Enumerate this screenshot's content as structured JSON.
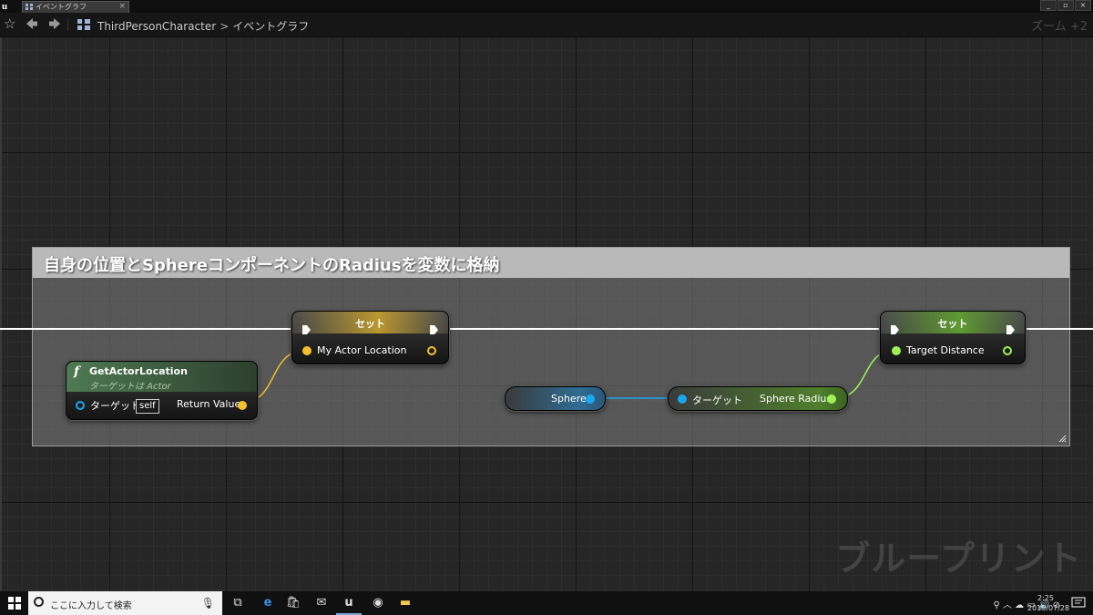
{
  "window": {
    "tab_label": "イベントグラフ",
    "tab_close": "×",
    "controls": [
      "_",
      "▫",
      "×"
    ]
  },
  "toolbar": {
    "breadcrumb_root": "ThirdPersonCharacter",
    "breadcrumb_sep": ">",
    "breadcrumb_current": "イベントグラフ",
    "zoom_label": "ズーム +2"
  },
  "comment": {
    "title": "自身の位置とSphereコンポーネントのRadiusを変数に格納"
  },
  "nodes": {
    "get_actor_location": {
      "icon": "f",
      "title": "GetActorLocation",
      "subtitle": "ターゲットは Actor",
      "target_label": "ターゲット",
      "self_label": "self",
      "return_label": "Return Value"
    },
    "set_actor_location": {
      "title": "セット",
      "var_label": "My Actor Location"
    },
    "sphere": {
      "label": "Sphere"
    },
    "sphere_radius": {
      "target_label": "ターゲット",
      "output_label": "Sphere Radius"
    },
    "set_target_distance": {
      "title": "セット",
      "var_label": "Target Distance"
    }
  },
  "watermark": "ブループリント",
  "taskbar": {
    "search_placeholder": "ここに入力して検索",
    "clock_time": "2:25",
    "clock_date": "2019/07/28"
  },
  "colors": {
    "vector_pin": "#f2c12e",
    "object_pin": "#19a8f0",
    "float_pin": "#9ef255",
    "exec_wire": "#ffffff",
    "set_vector_header": "#b9982f",
    "set_float_header": "#5f9a32",
    "function_header": "#4e7a52",
    "sphere_node": "#2f6d94"
  }
}
